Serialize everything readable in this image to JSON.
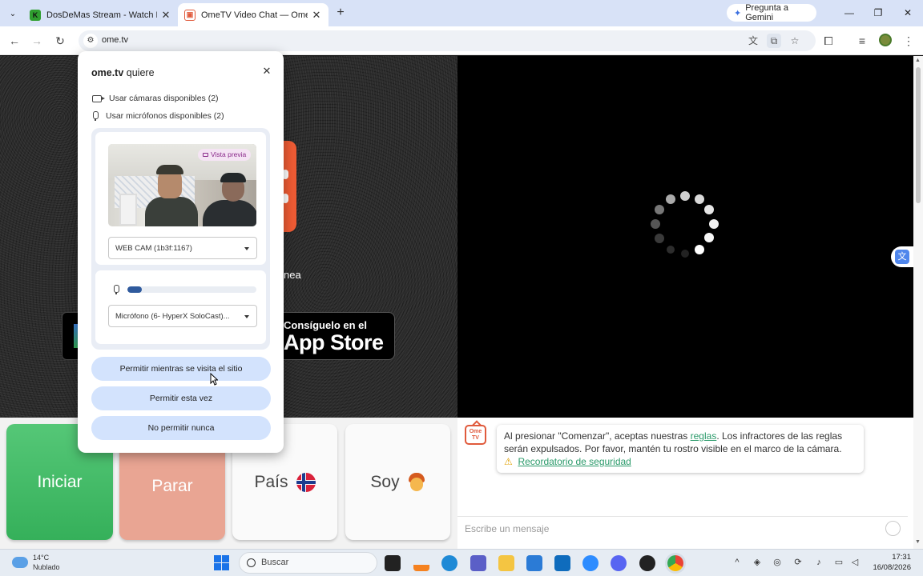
{
  "browser": {
    "tabs": [
      {
        "title": "DosDeMas Stream - Watch Live",
        "favicon": "kick-favicon",
        "active": false
      },
      {
        "title": "OmeTV Video Chat — Omegle",
        "favicon": "ometv-favicon",
        "active": true
      }
    ],
    "gemini_button": "Pregunta a Gemini",
    "url": "ome.tv"
  },
  "permission_prompt": {
    "site": "ome.tv",
    "title_suffix": "quiere",
    "camera_request": "Usar cámaras disponibles (2)",
    "mic_request": "Usar micrófonos disponibles (2)",
    "preview_badge": "Vista previa",
    "camera_select": "WEB CAM (1b3f:1167)",
    "mic_select": "Micrófono (6- HyperX SoloCast)...",
    "mic_level": 0.11,
    "buttons": {
      "allow_while_visiting": "Permitir mientras se visita el sitio",
      "allow_once": "Permitir esta vez",
      "never_allow": "No permitir nunca"
    }
  },
  "page": {
    "partial_text": "nea",
    "appstore_small": "Consíguelo en el",
    "appstore_big": "App Store",
    "controls": {
      "start": "Iniciar",
      "stop": "Parar",
      "country": "País",
      "gender": "Soy"
    },
    "chat": {
      "notice_before_link": "Al presionar \"Comenzar\", aceptas nuestras ",
      "rules_link": "reglas",
      "notice_after_link": ". Los infractores de las reglas serán expulsados. Por favor, mantén tu rostro visible en el marco de la cámara.",
      "safety_link": "Recordatorio de seguridad",
      "logo_text": "Ome TV",
      "message_placeholder": "Escribe un mensaje"
    }
  },
  "taskbar": {
    "temperature": "14°C",
    "weather": "Nublado",
    "search": "Buscar",
    "time": "17:31",
    "date": "16/08/2026"
  },
  "colors": {
    "start_button": "#3fb863",
    "stop_button": "#e9a593",
    "accent_link": "#2a9a6a",
    "permission_button": "#d3e3fd",
    "tabstrip": "#d8e2f7"
  }
}
